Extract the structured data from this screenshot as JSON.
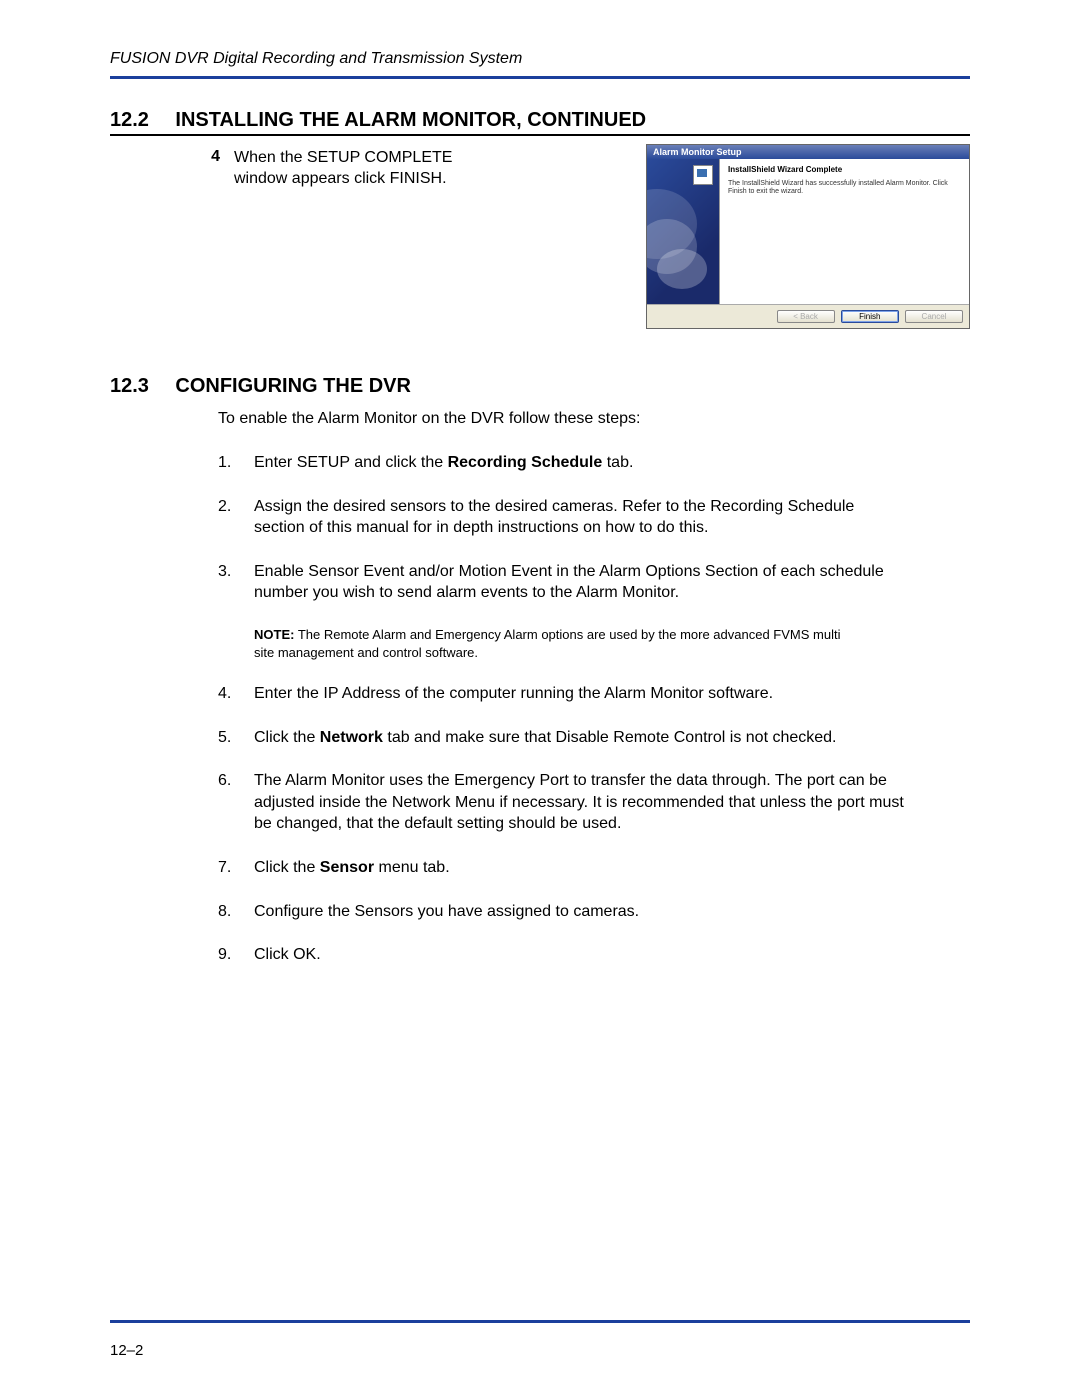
{
  "header": {
    "doc_title": "FUSION DVR Digital Recording and Transmission System"
  },
  "section_12_2": {
    "number": "12.2",
    "title": "INSTALLING THE ALARM MONITOR, CONTINUED",
    "step_number": "4",
    "step_text": "When the SETUP COMPLETE window appears click FINISH."
  },
  "wizard": {
    "titlebar": "Alarm Monitor Setup",
    "heading": "InstallShield Wizard Complete",
    "paragraph": "The InstallShield Wizard has successfully installed Alarm Monitor. Click Finish to exit the wizard.",
    "buttons": {
      "back": "< Back",
      "finish": "Finish",
      "cancel": "Cancel"
    }
  },
  "section_12_3": {
    "number": "12.3",
    "title": "CONFIGURING THE DVR",
    "intro": "To enable the Alarm Monitor on the DVR follow these steps:",
    "steps": [
      {
        "n": "1.",
        "pre": "Enter SETUP and click the ",
        "bold": "Recording Schedule",
        "post": " tab."
      },
      {
        "n": "2.",
        "text": "Assign the desired sensors to the desired cameras. Refer to the Recording Schedule section of this manual for in depth instructions on how to do this."
      },
      {
        "n": "3.",
        "text": "Enable Sensor Event and/or Motion Event in the Alarm Options Section of each schedule number you wish to send alarm events to the Alarm Monitor."
      }
    ],
    "note_label": "NOTE:",
    "note_text": " The Remote Alarm and Emergency Alarm options are used by the more advanced FVMS multi site management and control software.",
    "steps2": [
      {
        "n": "4.",
        "text": "Enter the IP Address of the computer running the Alarm Monitor software."
      },
      {
        "n": "5.",
        "pre": "Click the ",
        "bold": "Network",
        "post": " tab and make sure that Disable Remote Control is not checked."
      },
      {
        "n": "6.",
        "text": "The Alarm Monitor uses the Emergency Port to transfer the data through. The port can be adjusted inside the Network Menu if necessary. It is recommended that unless the port must be changed, that the default setting should be used."
      },
      {
        "n": "7.",
        "pre": "Click the ",
        "bold": "Sensor",
        "post": " menu tab."
      },
      {
        "n": "8.",
        "text": "Configure the Sensors you have assigned to cameras."
      },
      {
        "n": "9.",
        "text": "Click OK."
      }
    ]
  },
  "footer": {
    "page_number": "12–2"
  }
}
